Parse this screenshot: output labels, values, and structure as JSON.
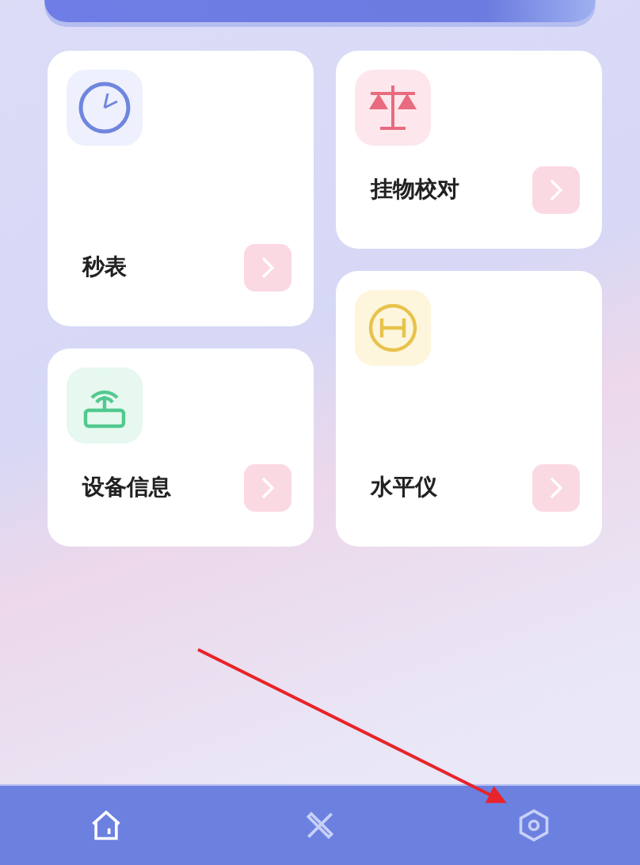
{
  "tool_cards": [
    {
      "kind": "clock",
      "title": "秒表"
    },
    {
      "kind": "router",
      "title": "设备信息"
    },
    {
      "kind": "scale",
      "title": "挂物校对"
    },
    {
      "kind": "level",
      "title": "水平仪"
    }
  ],
  "bottom_nav": [
    {
      "kind": "home",
      "selected": true
    },
    {
      "kind": "tools",
      "selected": false
    },
    {
      "kind": "settings",
      "selected": false
    }
  ]
}
